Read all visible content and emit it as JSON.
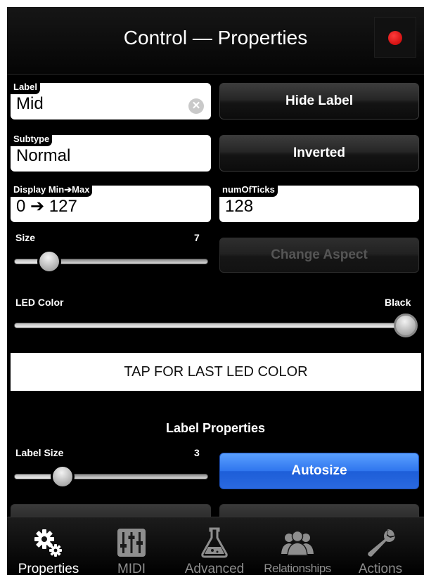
{
  "header": {
    "title": "Control — Properties"
  },
  "fields": {
    "label": {
      "tag": "Label",
      "value": "Mid"
    },
    "subtype": {
      "tag": "Subtype",
      "value": "Normal"
    },
    "display_range": {
      "tag": "Display Min➔Max",
      "value": "0 ➔ 127"
    },
    "num_ticks": {
      "tag": "numOfTicks",
      "value": "128"
    }
  },
  "buttons": {
    "hide_label": "Hide Label",
    "inverted": "Inverted",
    "change_aspect": "Change Aspect",
    "tap_last_led": "TAP FOR LAST LED COLOR",
    "autosize": "Autosize"
  },
  "sliders": {
    "size": {
      "label": "Size",
      "value": "7",
      "fraction": 0.18
    },
    "led_color": {
      "label": "LED Color",
      "value": "Black",
      "fraction": 1.0
    },
    "label_size": {
      "label": "Label Size",
      "value": "3",
      "fraction": 0.25
    }
  },
  "sections": {
    "label_properties": "Label Properties"
  },
  "tabbar": {
    "tabs": [
      {
        "label": "Properties",
        "icon": "gears-icon",
        "active": true
      },
      {
        "label": "MIDI",
        "icon": "mixer-icon",
        "active": false
      },
      {
        "label": "Advanced",
        "icon": "flask-icon",
        "active": false
      },
      {
        "label": "Relationships",
        "icon": "people-icon",
        "active": false
      },
      {
        "label": "Actions",
        "icon": "wrench-icon",
        "active": false
      }
    ]
  },
  "colors": {
    "record": "#e00000",
    "accent_blue": "#2f76ee",
    "background": "#000000"
  }
}
